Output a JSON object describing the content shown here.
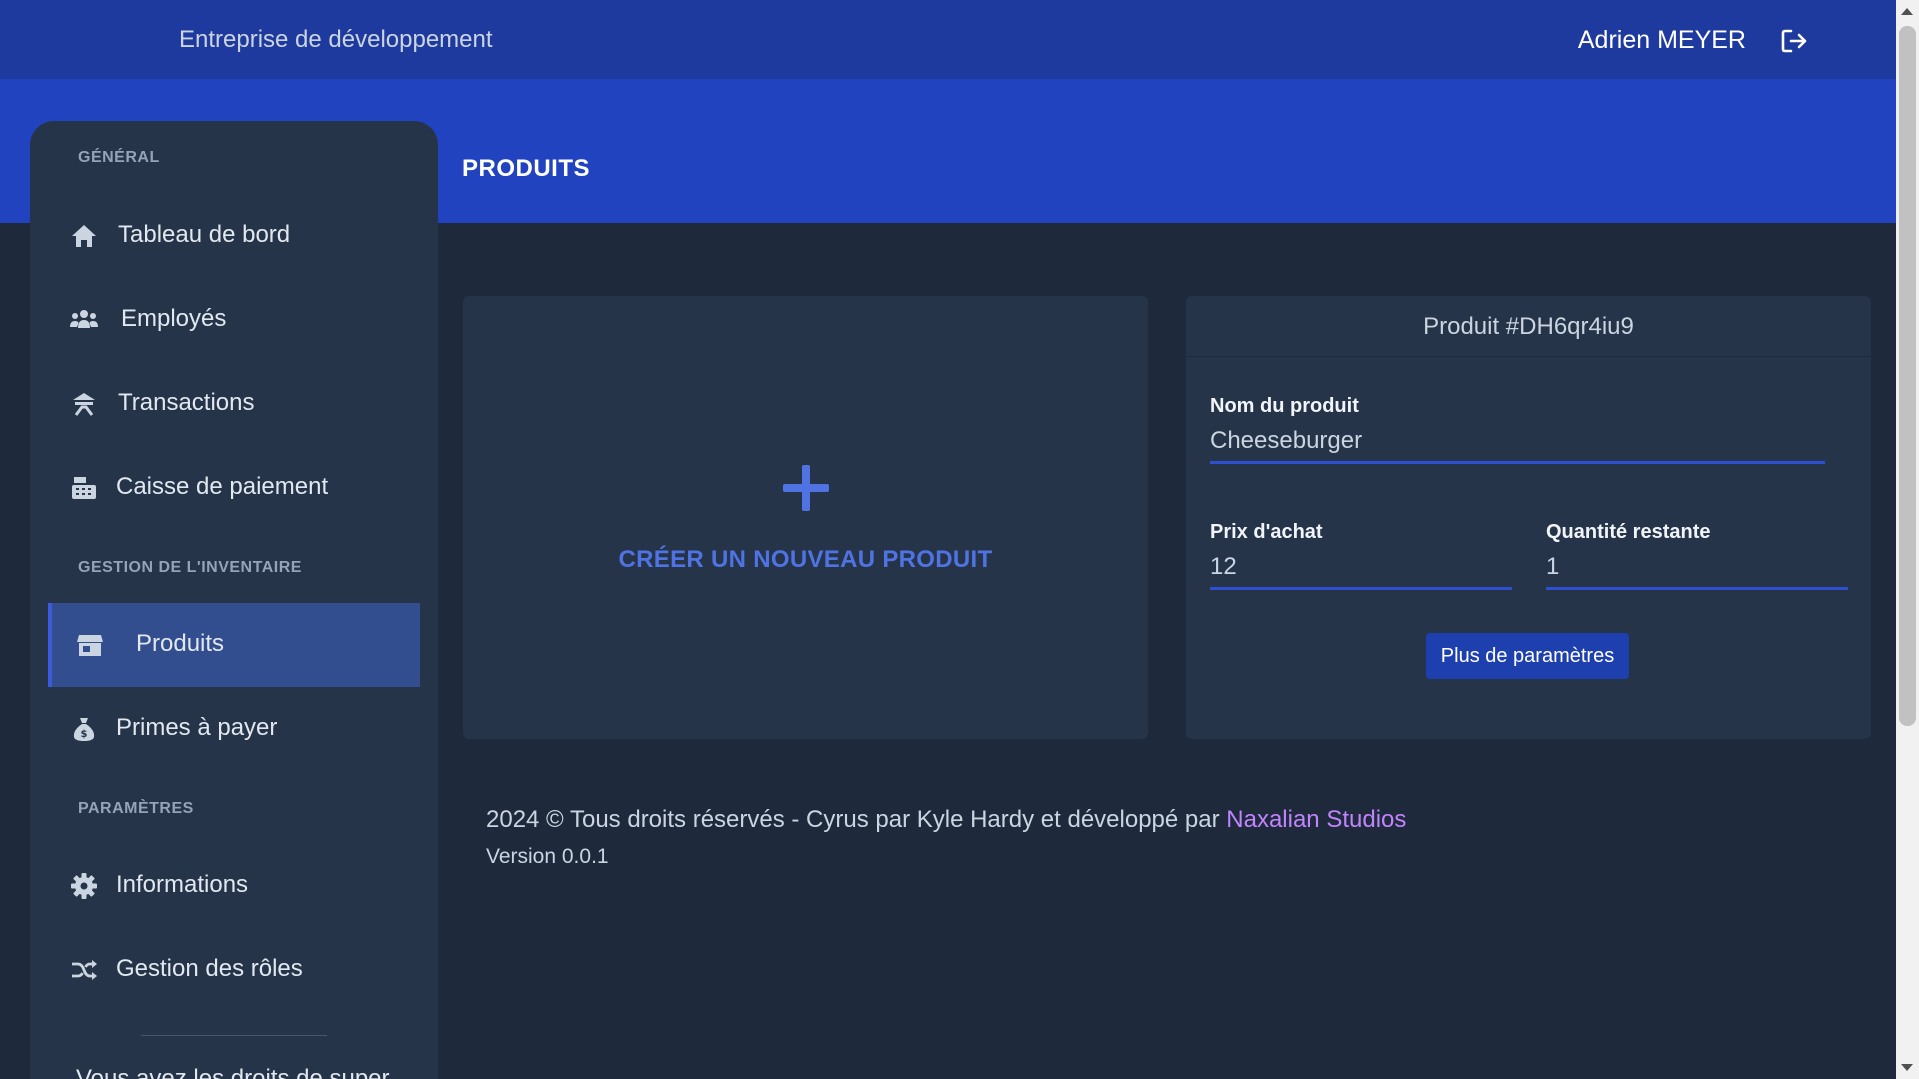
{
  "header": {
    "company": "Entreprise de développement",
    "user": "Adrien MEYER"
  },
  "page": {
    "title": "PRODUITS"
  },
  "sidebar": {
    "sections": [
      {
        "title": "GÉNÉRAL"
      },
      {
        "title": "GESTION DE L'INVENTAIRE"
      },
      {
        "title": "PARAMÈTRES"
      }
    ],
    "items": [
      {
        "label": "Tableau de bord",
        "icon": "home-icon"
      },
      {
        "label": "Employés",
        "icon": "users-icon"
      },
      {
        "label": "Transactions",
        "icon": "transactions-icon"
      },
      {
        "label": "Caisse de paiement",
        "icon": "cash-register-icon"
      },
      {
        "label": "Produits",
        "icon": "store-icon",
        "active": true
      },
      {
        "label": "Primes à payer",
        "icon": "money-bag-icon"
      },
      {
        "label": "Informations",
        "icon": "gear-icon"
      },
      {
        "label": "Gestion des rôles",
        "icon": "shuffle-icon"
      }
    ],
    "note": "Vous avez les droits de super"
  },
  "create_card": {
    "label": "CRÉER UN NOUVEAU PRODUIT"
  },
  "product_card": {
    "title": "Produit #DH6qr4iu9",
    "name_label": "Nom du produit",
    "name_value": "Cheeseburger",
    "price_label": "Prix d'achat",
    "price_value": "12",
    "quantity_label": "Quantité restante",
    "quantity_value": "1",
    "more_button": "Plus de paramètres"
  },
  "footer": {
    "copyright": "2024 © Tous droits réservés - Cyrus par Kyle Hardy et développé par ",
    "link": "Naxalian Studios",
    "version": "Version 0.0.1"
  },
  "colors": {
    "topbar": "#1e3a9e",
    "hero": "#2143bf",
    "background": "#1e293b",
    "card": "#253449",
    "accent": "#4f73e3",
    "link": "#c084fc"
  }
}
